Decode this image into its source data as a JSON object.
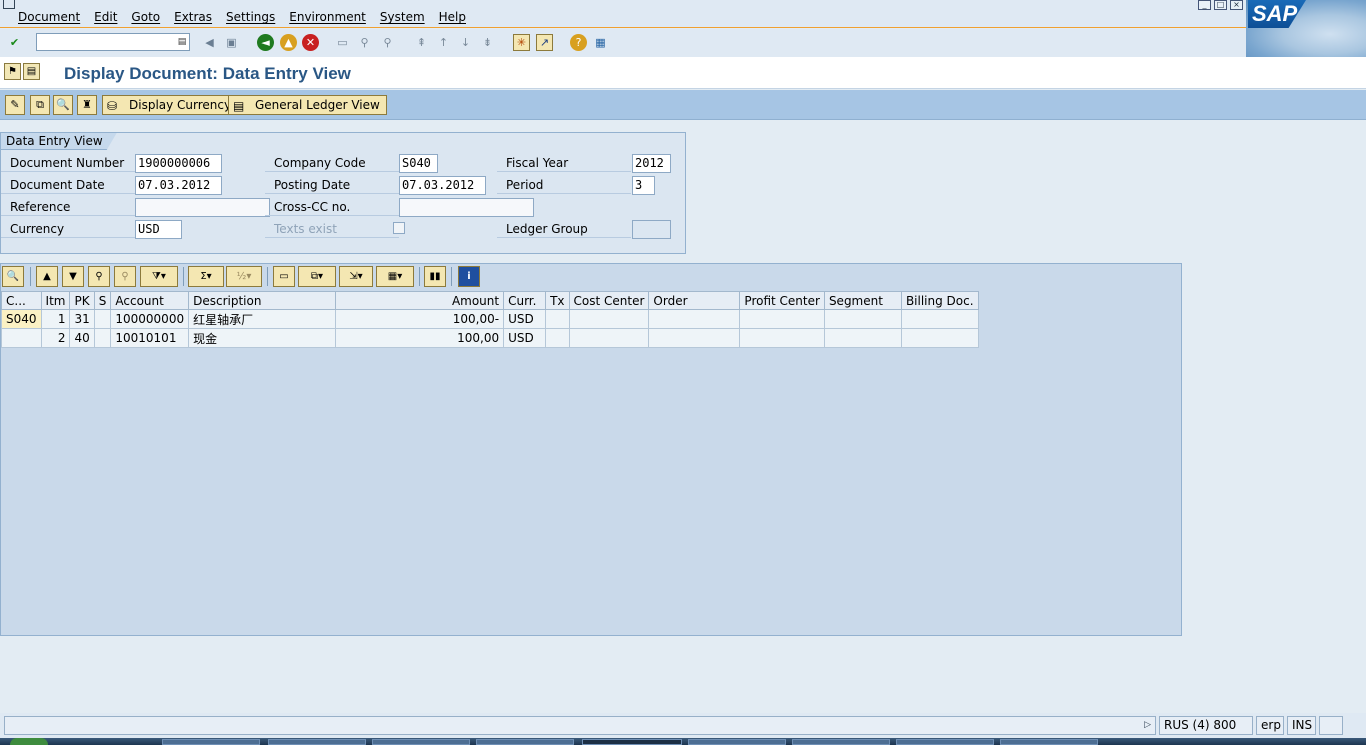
{
  "menu": [
    "Document",
    "Edit",
    "Goto",
    "Extras",
    "Settings",
    "Environment",
    "System",
    "Help"
  ],
  "window_controls": [
    "_",
    "□",
    "×"
  ],
  "logo": "SAP",
  "title": "Display Document: Data Entry View",
  "app_toolbar": {
    "display_currency": "Display Currency",
    "general_ledger_view": "General Ledger View"
  },
  "header": {
    "tab": "Data Entry View",
    "document_number": {
      "label": "Document Number",
      "value": "1900000006"
    },
    "company_code": {
      "label": "Company Code",
      "value": "S040"
    },
    "fiscal_year": {
      "label": "Fiscal Year",
      "value": "2012"
    },
    "document_date": {
      "label": "Document Date",
      "value": "07.03.2012"
    },
    "posting_date": {
      "label": "Posting Date",
      "value": "07.03.2012"
    },
    "period": {
      "label": "Period",
      "value": "3"
    },
    "reference": {
      "label": "Reference",
      "value": ""
    },
    "cross_cc": {
      "label": "Cross-CC no.",
      "value": ""
    },
    "currency": {
      "label": "Currency",
      "value": "USD"
    },
    "texts_exist": {
      "label": "Texts exist",
      "checked": false
    },
    "ledger_group": {
      "label": "Ledger Group",
      "value": ""
    }
  },
  "grid": {
    "columns": [
      "C...",
      "Itm",
      "PK",
      "S",
      "Account",
      "Description",
      "Amount",
      "Curr.",
      "Tx",
      "Cost Center",
      "Order",
      "Profit Center",
      "Segment",
      "Billing Doc."
    ],
    "rows": [
      [
        "S040",
        "1",
        "31",
        "",
        "100000000",
        "红星轴承厂",
        "100,00-",
        "USD",
        "",
        "",
        "",
        "",
        "",
        ""
      ],
      [
        "",
        "2",
        "40",
        "",
        "10010101",
        "现金",
        "100,00",
        "USD",
        "",
        "",
        "",
        "",
        "",
        ""
      ]
    ]
  },
  "status": {
    "system": "RUS (4) 800",
    "server": "erp",
    "mode": "INS"
  }
}
